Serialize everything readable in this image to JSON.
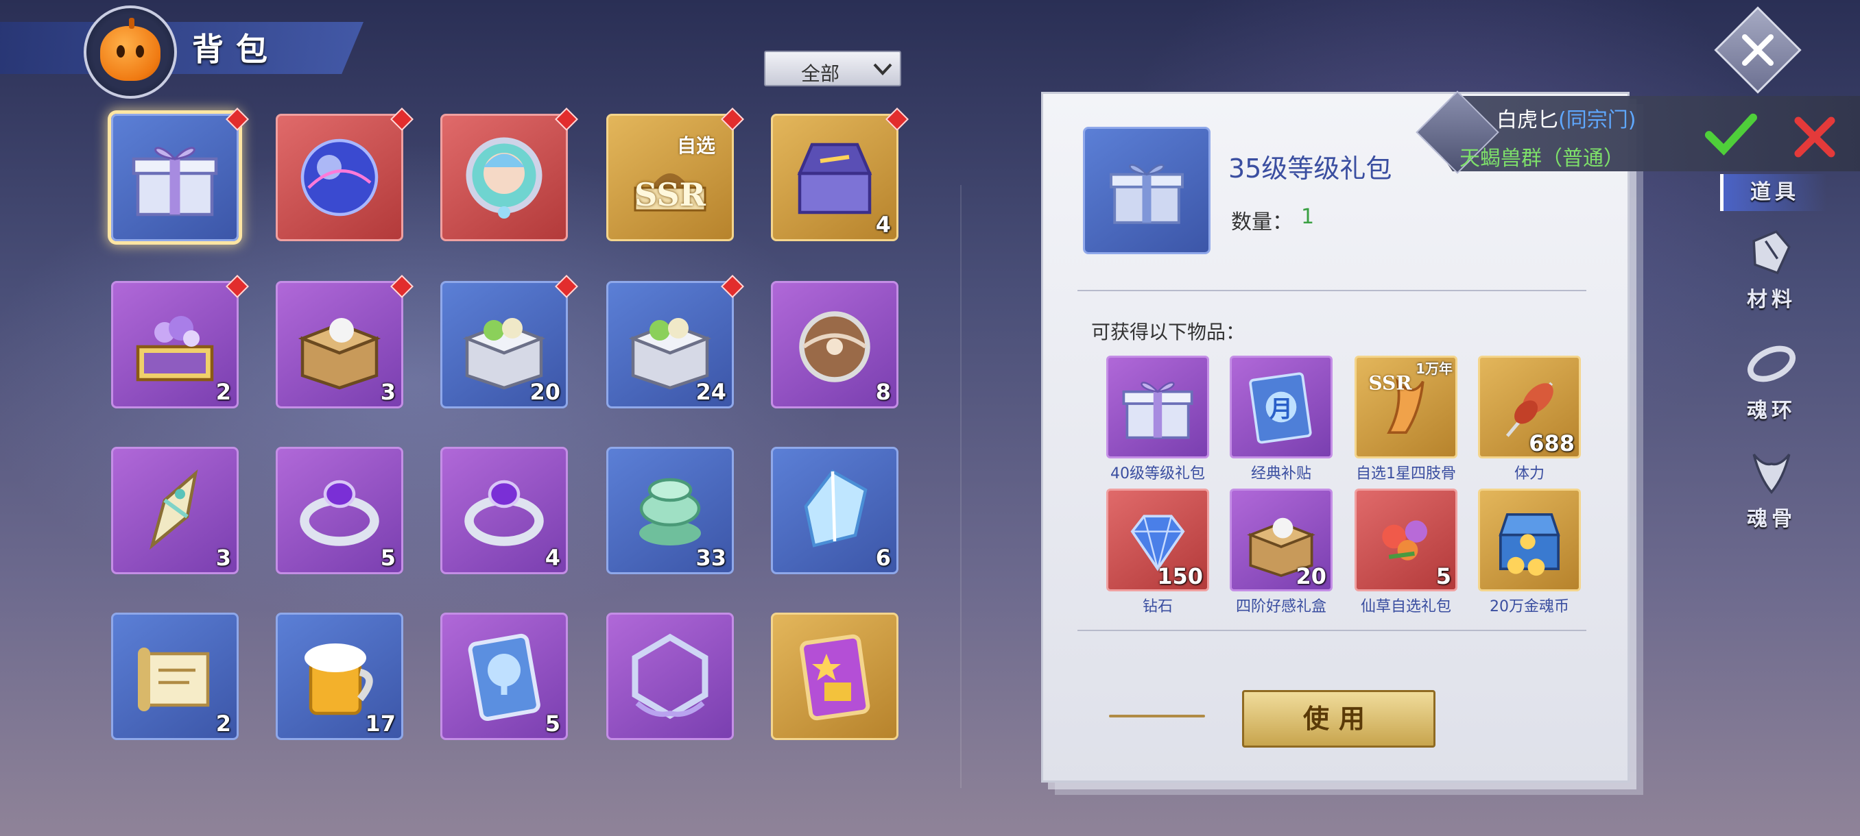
{
  "header": {
    "title": "背包"
  },
  "filter": {
    "selected": "全部"
  },
  "inventory": [
    {
      "rarity": "blue",
      "icon": "gift-box-icon",
      "count": "",
      "new": true,
      "selected": true
    },
    {
      "rarity": "red",
      "icon": "crystal-orb-icon",
      "count": "",
      "new": true
    },
    {
      "rarity": "red",
      "icon": "soul-portrait-icon",
      "count": "",
      "new": true
    },
    {
      "rarity": "gold",
      "icon": "ssr-selector-icon",
      "count": "",
      "new": true,
      "tag": "自选",
      "emblem": "SSR"
    },
    {
      "rarity": "gold",
      "icon": "treasure-chest-icon",
      "count": "4",
      "new": true
    },
    {
      "rarity": "purple",
      "icon": "flower-chest-icon",
      "count": "2",
      "new": true
    },
    {
      "rarity": "purple",
      "icon": "wooden-crate-icon",
      "count": "3",
      "new": true
    },
    {
      "rarity": "blue",
      "icon": "silver-crate-icon",
      "count": "20",
      "new": true
    },
    {
      "rarity": "blue",
      "icon": "silver-crate-icon",
      "count": "24",
      "new": true
    },
    {
      "rarity": "purple",
      "icon": "bronze-orb-icon",
      "count": "8",
      "new": false
    },
    {
      "rarity": "purple",
      "icon": "crystal-shard-icon",
      "count": "3",
      "new": false
    },
    {
      "rarity": "purple",
      "icon": "amethyst-ring-icon",
      "count": "5",
      "new": false
    },
    {
      "rarity": "purple",
      "icon": "amethyst-ring-icon",
      "count": "4",
      "new": false
    },
    {
      "rarity": "blue",
      "icon": "jade-bowl-icon",
      "count": "33",
      "new": false
    },
    {
      "rarity": "blue",
      "icon": "ice-crystal-icon",
      "count": "6",
      "new": false
    },
    {
      "rarity": "blue",
      "icon": "scroll-icon",
      "count": "2",
      "new": false
    },
    {
      "rarity": "blue",
      "icon": "beer-mug-icon",
      "count": "17",
      "new": false
    },
    {
      "rarity": "purple",
      "icon": "tree-card-icon",
      "count": "5",
      "new": false
    },
    {
      "rarity": "purple",
      "icon": "hex-frame-icon",
      "count": "",
      "new": false
    },
    {
      "rarity": "gold",
      "icon": "star-card-icon",
      "count": "",
      "new": false
    }
  ],
  "detail": {
    "name": "35级等级礼包",
    "qty_label": "数量：",
    "qty": "1",
    "obtain_label": "可获得以下物品：",
    "rewards": [
      {
        "label": "40级等级礼包",
        "rarity": "purple",
        "icon": "gift-box-icon",
        "count": "",
        "tag": ""
      },
      {
        "label": "经典补贴",
        "rarity": "purple",
        "icon": "ticket-icon",
        "count": "",
        "tag": "",
        "emblem": "月"
      },
      {
        "label": "自选1星四肢骨",
        "rarity": "gold",
        "icon": "soul-bone-icon",
        "count": "",
        "tag": "1万年",
        "emblem": "SSR"
      },
      {
        "label": "体力",
        "rarity": "gold",
        "icon": "meat-skewer-icon",
        "count": "688",
        "tag": ""
      },
      {
        "label": "钻石",
        "rarity": "red",
        "icon": "diamond-icon",
        "count": "150",
        "tag": ""
      },
      {
        "label": "四阶好感礼盒",
        "rarity": "purple",
        "icon": "wooden-crate-icon",
        "count": "20",
        "tag": ""
      },
      {
        "label": "仙草自选礼包",
        "rarity": "red",
        "icon": "flower-bouquet-icon",
        "count": "5",
        "tag": ""
      },
      {
        "label": "20万金魂币",
        "rarity": "gold",
        "icon": "coin-chest-icon",
        "count": "",
        "tag": ""
      }
    ],
    "use_button": "使用"
  },
  "notification": {
    "name": "白虎匕",
    "sect": "(同宗门)",
    "message": "天蝎兽群（普通）"
  },
  "tabs": [
    {
      "label": "道具",
      "icon": "item-tab-icon",
      "active": true
    },
    {
      "label": "材料",
      "icon": "ore-icon",
      "active": false
    },
    {
      "label": "魂环",
      "icon": "soul-ring-icon",
      "active": false
    },
    {
      "label": "魂骨",
      "icon": "soul-bone-tab-icon",
      "active": false
    }
  ],
  "colors": {
    "accent_blue": "#3a4ea0",
    "quantity_green": "#3aa043",
    "notify_green": "#7ee06a",
    "sect_blue": "#5fa8ff",
    "new_badge": "#e22d2d"
  }
}
